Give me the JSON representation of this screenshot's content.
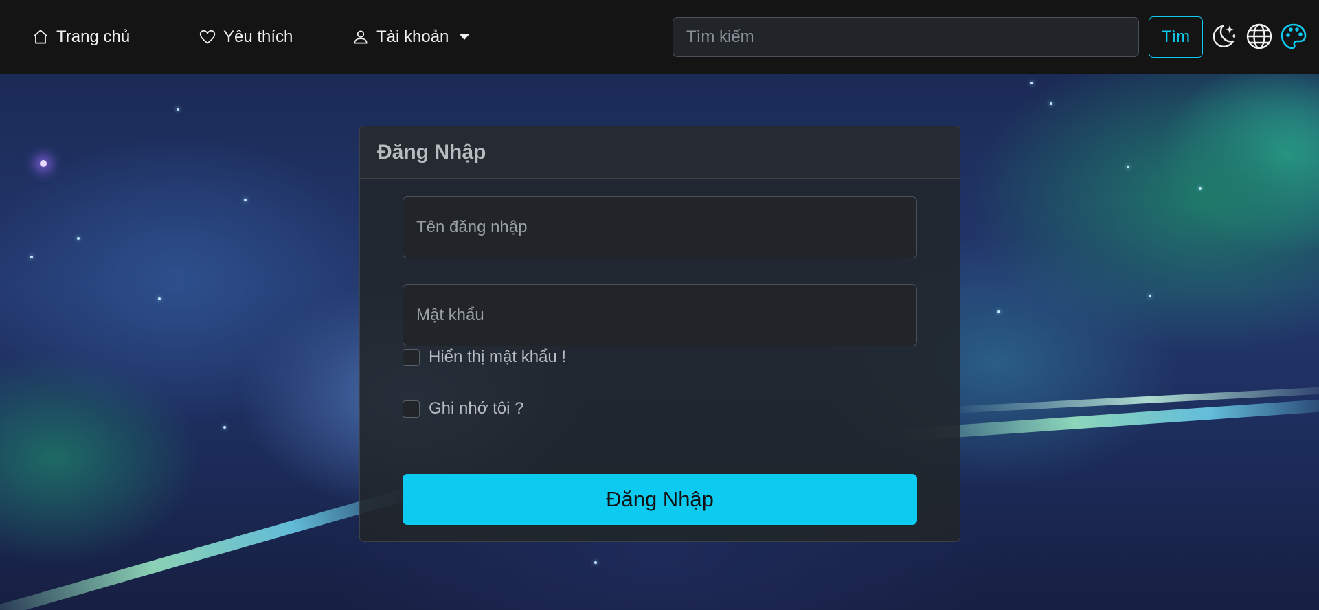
{
  "navbar": {
    "home_label": "Trang chủ",
    "favorites_label": "Yêu thích",
    "account_label": "Tài khoản",
    "search_placeholder": "Tìm kiếm",
    "search_button": "Tìm",
    "accent_color": "#0dcaf0",
    "icons": [
      "house-icon",
      "heart-icon",
      "person-icon",
      "moon-stars-icon",
      "globe-icon",
      "palette-icon"
    ]
  },
  "login": {
    "title": "Đăng Nhập",
    "username_placeholder": "Tên đăng nhập",
    "password_placeholder": "Mật khẩu",
    "show_password_label": "Hiển thị mật khẩu !",
    "remember_label": "Ghi nhớ tôi ?",
    "submit_label": "Đăng Nhập",
    "submit_color": "#0dcaf0"
  }
}
